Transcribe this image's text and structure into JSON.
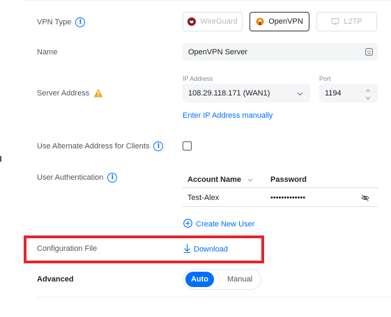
{
  "vpn_type": {
    "label": "VPN Type",
    "options": [
      {
        "label": "WireGuard",
        "icon": "wireguard-icon",
        "active": false
      },
      {
        "label": "OpenVPN",
        "icon": "openvpn-icon",
        "active": true
      },
      {
        "label": "L2TP",
        "icon": "l2tp-icon",
        "active": false
      }
    ]
  },
  "name": {
    "label": "Name",
    "value": "OpenVPN Server"
  },
  "server_address": {
    "label": "Server Address",
    "ip_caption": "IP Address",
    "ip_value": "108.29.118.171 (WAN1)",
    "port_caption": "Port",
    "port_value": "1194",
    "manual_link": "Enter IP Address manually"
  },
  "alternate_address": {
    "label": "Use Alternate Address for Clients",
    "checked": false
  },
  "user_auth": {
    "label": "User Authentication",
    "columns": [
      "Account Name",
      "Password"
    ],
    "rows": [
      {
        "account": "Test-Alex",
        "password": "•••••••••••••"
      }
    ],
    "create_link": "Create New User"
  },
  "config_file": {
    "label": "Configuration File",
    "download_label": "Download"
  },
  "advanced": {
    "label": "Advanced",
    "options": [
      "Auto",
      "Manual"
    ],
    "selected": "Auto"
  },
  "colors": {
    "accent": "#006fff",
    "highlight": "#e3262e",
    "warning": "#f5a623"
  }
}
